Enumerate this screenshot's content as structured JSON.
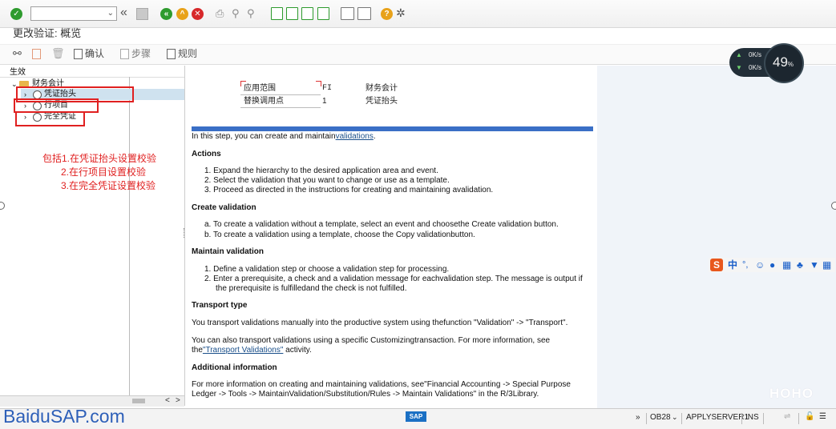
{
  "toolbar": {
    "command_field": "",
    "icons": [
      "check-icon",
      "back-double-icon",
      "save-icon",
      "back-icon",
      "exit-icon",
      "cancel-icon",
      "print-icon",
      "find-icon",
      "find-next-icon",
      "first-page-icon",
      "prev-page-icon",
      "next-page-icon",
      "last-page-icon",
      "new-session-icon",
      "shortcut-icon",
      "help-icon",
      "settings-icon"
    ]
  },
  "title": "更改验证: 概览",
  "app_toolbar": {
    "confirm": "确认",
    "step": "步骤",
    "rule": "规则"
  },
  "tree": {
    "header": "生效",
    "root": "财务会计",
    "items": [
      "凭证抬头",
      "行项目",
      "完全凭证"
    ]
  },
  "annotation": {
    "line1": "包括1.在凭证抬头设置校验",
    "line2": "2.在行项目设置校验",
    "line3": "3.在完全凭证设置校验"
  },
  "fields": {
    "app_area_label": "应用范围",
    "app_area_value": "FI",
    "app_area_desc": "财务会计",
    "callup_label": "替换调用点",
    "callup_value": "1",
    "callup_desc": "凭证抬头"
  },
  "help": {
    "intro_prefix": "In this step, you can create and maintain",
    "intro_link": "validations",
    "intro_suffix": ".",
    "actions_title": "Actions",
    "actions_1": "1.  Expand the hierarchy to the desired application area and event.",
    "actions_2": "2.  Select the validation that you want to change or use as a template.",
    "actions_3": "3.  Proceed as directed in the instructions for creating and maintaining avalidation.",
    "create_title": "Create validation",
    "create_a": "a.  To create a validation without a template, select an event and choosethe Create validation button.",
    "create_b": "b.  To create a validation using a template, choose the Copy validationbutton.",
    "maintain_title": "Maintain validation",
    "maintain_1": "1.  Define a validation step or choose a validation step for processing.",
    "maintain_2a": "2.  Enter a prerequisite, a check and a validation message for eachvalidation step. The message is output if",
    "maintain_2b": "the prerequisite is fulfilledand the check is not fulfilled.",
    "transport_title": "Transport type",
    "transport_1": "You transport validations manually into the productive system using thefunction \"Validation\" -> \"Transport\".",
    "transport_2a": "You can also transport validations using a specific Customizingtransaction. For more information, see",
    "transport_2b_prefix": "the",
    "transport_2b_link": "\"Transport Validations\"",
    "transport_2b_suffix": " activity.",
    "additional_title": "Additional information",
    "additional_1": "For more information on creating and maintaining validations, see\"Financial Accounting -> Special Purpose",
    "additional_2": "Ledger -> Tools -> MaintainValidation/Substitution/Rules -> Maintain Validations\" in the R/3Library."
  },
  "status": {
    "tcode": "OB28",
    "server": "APPLYSERVER1",
    "mode": "INS",
    "sap_logo": "SAP"
  },
  "speed_widget": {
    "up": "0K/s",
    "down": "0K/s",
    "percent": "49",
    "percent_unit": "%"
  },
  "ime": {
    "logo": "S",
    "lang": "中"
  },
  "watermarks": {
    "baidu": "BaiduSAP.com",
    "hoho": "HOHO"
  },
  "colors": {
    "blue_rule": "#3a6fc6",
    "annotation_red": "#e02020"
  }
}
